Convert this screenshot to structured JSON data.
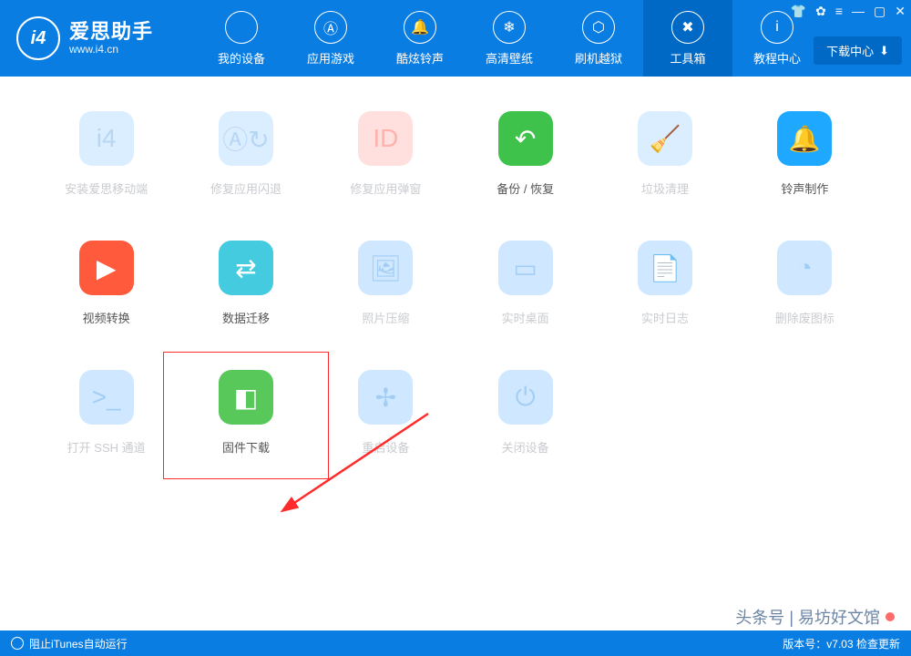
{
  "app": {
    "name_cn": "爱思助手",
    "name_en": "www.i4.cn",
    "logo_text": "i4"
  },
  "window_controls": {
    "shirt": "👕",
    "gear": "✿",
    "menu": "≡",
    "min": "—",
    "max": "▢",
    "close": "✕",
    "download_center": "下载中心"
  },
  "nav": [
    {
      "key": "device",
      "label": "我的设备",
      "icon": ""
    },
    {
      "key": "apps",
      "label": "应用游戏",
      "icon": "Ⓐ"
    },
    {
      "key": "ringtone",
      "label": "酷炫铃声",
      "icon": "🔔"
    },
    {
      "key": "wallpaper",
      "label": "高清壁纸",
      "icon": "❄"
    },
    {
      "key": "flash",
      "label": "刷机越狱",
      "icon": "⬡"
    },
    {
      "key": "tools",
      "label": "工具箱",
      "icon": "✖",
      "active": true
    },
    {
      "key": "tutorial",
      "label": "教程中心",
      "icon": "i"
    }
  ],
  "tools": {
    "row1": [
      {
        "key": "install-mobile",
        "label": "安装爱思移动端",
        "color": "pale-blue",
        "text_class": "muted",
        "icon": "i4"
      },
      {
        "key": "fix-crash",
        "label": "修复应用闪退",
        "color": "pale-blue",
        "text_class": "muted",
        "icon": "Ⓐ↻"
      },
      {
        "key": "fix-popup",
        "label": "修复应用弹窗",
        "color": "pale-red",
        "text_class": "muted",
        "icon": "ID"
      },
      {
        "key": "backup-restore",
        "label": "备份 / 恢复",
        "color": "green",
        "text_class": "normal",
        "icon": "↶"
      },
      {
        "key": "trash-clean",
        "label": "垃圾清理",
        "color": "pale-blue",
        "text_class": "muted",
        "icon": "🧹"
      },
      {
        "key": "ringtone-make",
        "label": "铃声制作",
        "color": "blue",
        "text_class": "normal",
        "icon": "🔔"
      }
    ],
    "row2": [
      {
        "key": "video-convert",
        "label": "视频转换",
        "color": "orange",
        "text_class": "normal",
        "icon": "▶"
      },
      {
        "key": "data-migrate",
        "label": "数据迁移",
        "color": "cyan",
        "text_class": "normal",
        "icon": "⇄"
      },
      {
        "key": "photo-compress",
        "label": "照片压缩",
        "color": "pale-blue2",
        "text_class": "muted",
        "icon": "🖼"
      },
      {
        "key": "live-desktop",
        "label": "实时桌面",
        "color": "pale-blue2",
        "text_class": "muted",
        "icon": "▭"
      },
      {
        "key": "live-log",
        "label": "实时日志",
        "color": "pale-blue2",
        "text_class": "muted",
        "icon": "📄"
      },
      {
        "key": "del-dead-icon",
        "label": "删除废图标",
        "color": "pale-blue2",
        "text_class": "muted",
        "icon": "◔"
      }
    ],
    "row3": [
      {
        "key": "open-ssh",
        "label": "打开 SSH 通道",
        "color": "pale-blue2",
        "text_class": "muted",
        "icon": ">_"
      },
      {
        "key": "firmware-dl",
        "label": "固件下载",
        "color": "green2",
        "text_class": "normal",
        "icon": "◧",
        "highlighted": true
      },
      {
        "key": "restart-device",
        "label": "重启设备",
        "color": "pale-blue2",
        "text_class": "muted",
        "icon": "✢"
      },
      {
        "key": "shutdown-device",
        "label": "关闭设备",
        "color": "pale-blue2",
        "text_class": "muted",
        "icon": "⏻"
      }
    ]
  },
  "statusbar": {
    "left": "阻止iTunes自动运行",
    "right": "版本号：v7.03 检查更新"
  },
  "watermark": "头条号 | 易坊好文馆"
}
